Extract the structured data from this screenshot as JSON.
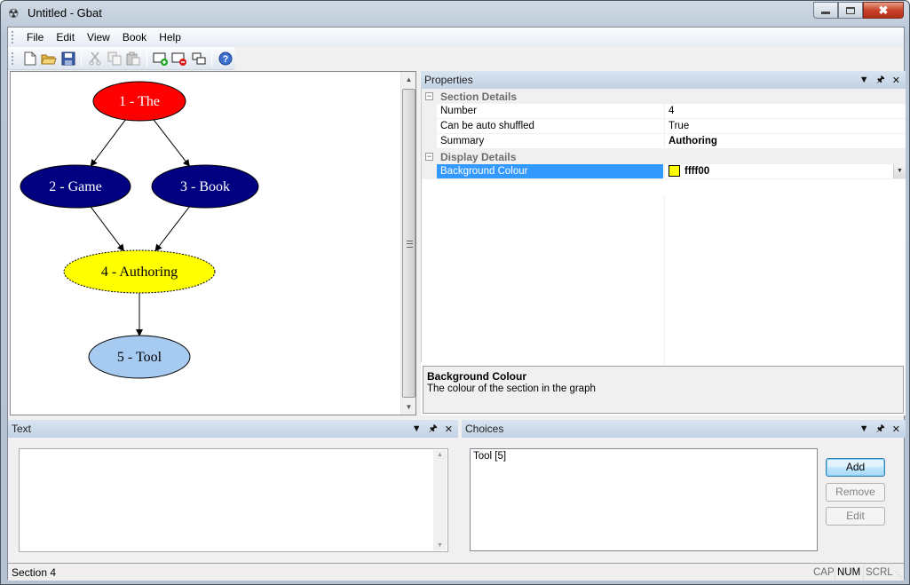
{
  "window": {
    "title": "Untitled - Gbat",
    "icon": "gbat-app-icon",
    "controls": {
      "minimize": "minimize-icon",
      "maximize": "maximize-icon",
      "close": "close-icon"
    }
  },
  "menu": [
    {
      "label": "File",
      "accel": "F"
    },
    {
      "label": "Edit",
      "accel": "E"
    },
    {
      "label": "View",
      "accel": "V"
    },
    {
      "label": "Book",
      "accel": "B"
    },
    {
      "label": "Help",
      "accel": "H"
    }
  ],
  "toolbar": [
    {
      "name": "new-icon",
      "enabled": true
    },
    {
      "name": "open-icon",
      "enabled": true
    },
    {
      "name": "save-icon",
      "enabled": true
    },
    {
      "name": "cut-icon",
      "enabled": false
    },
    {
      "name": "copy-icon",
      "enabled": false
    },
    {
      "name": "paste-icon",
      "enabled": false
    },
    {
      "name": "add-section-icon",
      "enabled": true
    },
    {
      "name": "remove-section-icon",
      "enabled": true
    },
    {
      "name": "link-sections-icon",
      "enabled": true
    },
    {
      "name": "help-icon",
      "enabled": true
    }
  ],
  "graph": {
    "nodes": [
      {
        "id": 1,
        "label": "1 - The",
        "fill": "#ff0000",
        "text": "#ffffff",
        "dashed": false
      },
      {
        "id": 2,
        "label": "2 - Game",
        "fill": "#000080",
        "text": "#ffffff",
        "dashed": false
      },
      {
        "id": 3,
        "label": "3 - Book",
        "fill": "#000080",
        "text": "#ffffff",
        "dashed": false
      },
      {
        "id": 4,
        "label": "4 - Authoring",
        "fill": "#ffff00",
        "text": "#000000",
        "dashed": true
      },
      {
        "id": 5,
        "label": "5 - Tool",
        "fill": "#a6caf0",
        "text": "#000000",
        "dashed": false
      }
    ],
    "edges": [
      [
        1,
        2
      ],
      [
        1,
        3
      ],
      [
        2,
        4
      ],
      [
        3,
        4
      ],
      [
        4,
        5
      ]
    ]
  },
  "properties": {
    "title": "Properties",
    "categories": [
      {
        "label": "Section Details",
        "rows": [
          {
            "name": "Number",
            "value": "4",
            "bold": false
          },
          {
            "name": "Can be auto shuffled",
            "value": "True",
            "bold": false
          },
          {
            "name": "Summary",
            "value": "Authoring",
            "bold": true
          }
        ]
      },
      {
        "label": "Display Details",
        "rows": [
          {
            "name": "Background Colour",
            "value": "ffff00",
            "bold": true,
            "swatch": "#ffff00",
            "selected": true
          }
        ]
      }
    ],
    "help": {
      "title": "Background Colour",
      "description": "The colour of the section in the graph"
    }
  },
  "text_panel": {
    "title": "Text",
    "content": ""
  },
  "choices_panel": {
    "title": "Choices",
    "items": [
      "Tool [5]"
    ],
    "buttons": {
      "add": "Add",
      "remove": "Remove",
      "edit": "Edit"
    }
  },
  "statusbar": {
    "text": "Section 4",
    "indicators": [
      {
        "label": "CAP",
        "active": false
      },
      {
        "label": "NUM",
        "active": true
      },
      {
        "label": "SCRL",
        "active": false
      }
    ]
  }
}
